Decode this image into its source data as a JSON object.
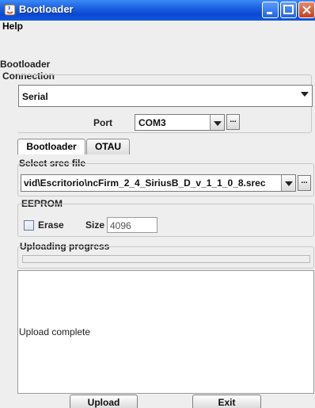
{
  "window": {
    "title": "Bootloader"
  },
  "menu": {
    "help": "Help"
  },
  "main": {
    "section_label": "Bootloader",
    "connection": {
      "title": "Connection",
      "type_value": "Serial",
      "port_label": "Port",
      "port_value": "COM3"
    },
    "tabs": [
      {
        "label": "Bootloader"
      },
      {
        "label": "OTAU"
      }
    ],
    "srec": {
      "title": "Select srec file",
      "path": "vid\\Escritorio\\ncFirm_2_4_SiriusB_D_v_1_1_0_8.srec",
      "browse": "..."
    },
    "eeprom": {
      "title": "EEPROM",
      "erase_label": "Erase",
      "size_label": "Size",
      "size_value": "4096"
    },
    "progress": {
      "title": "Uploading progress",
      "value": 0
    },
    "log": {
      "text": "Upload complete"
    },
    "buttons": {
      "upload": "Upload",
      "exit": "Exit"
    }
  }
}
